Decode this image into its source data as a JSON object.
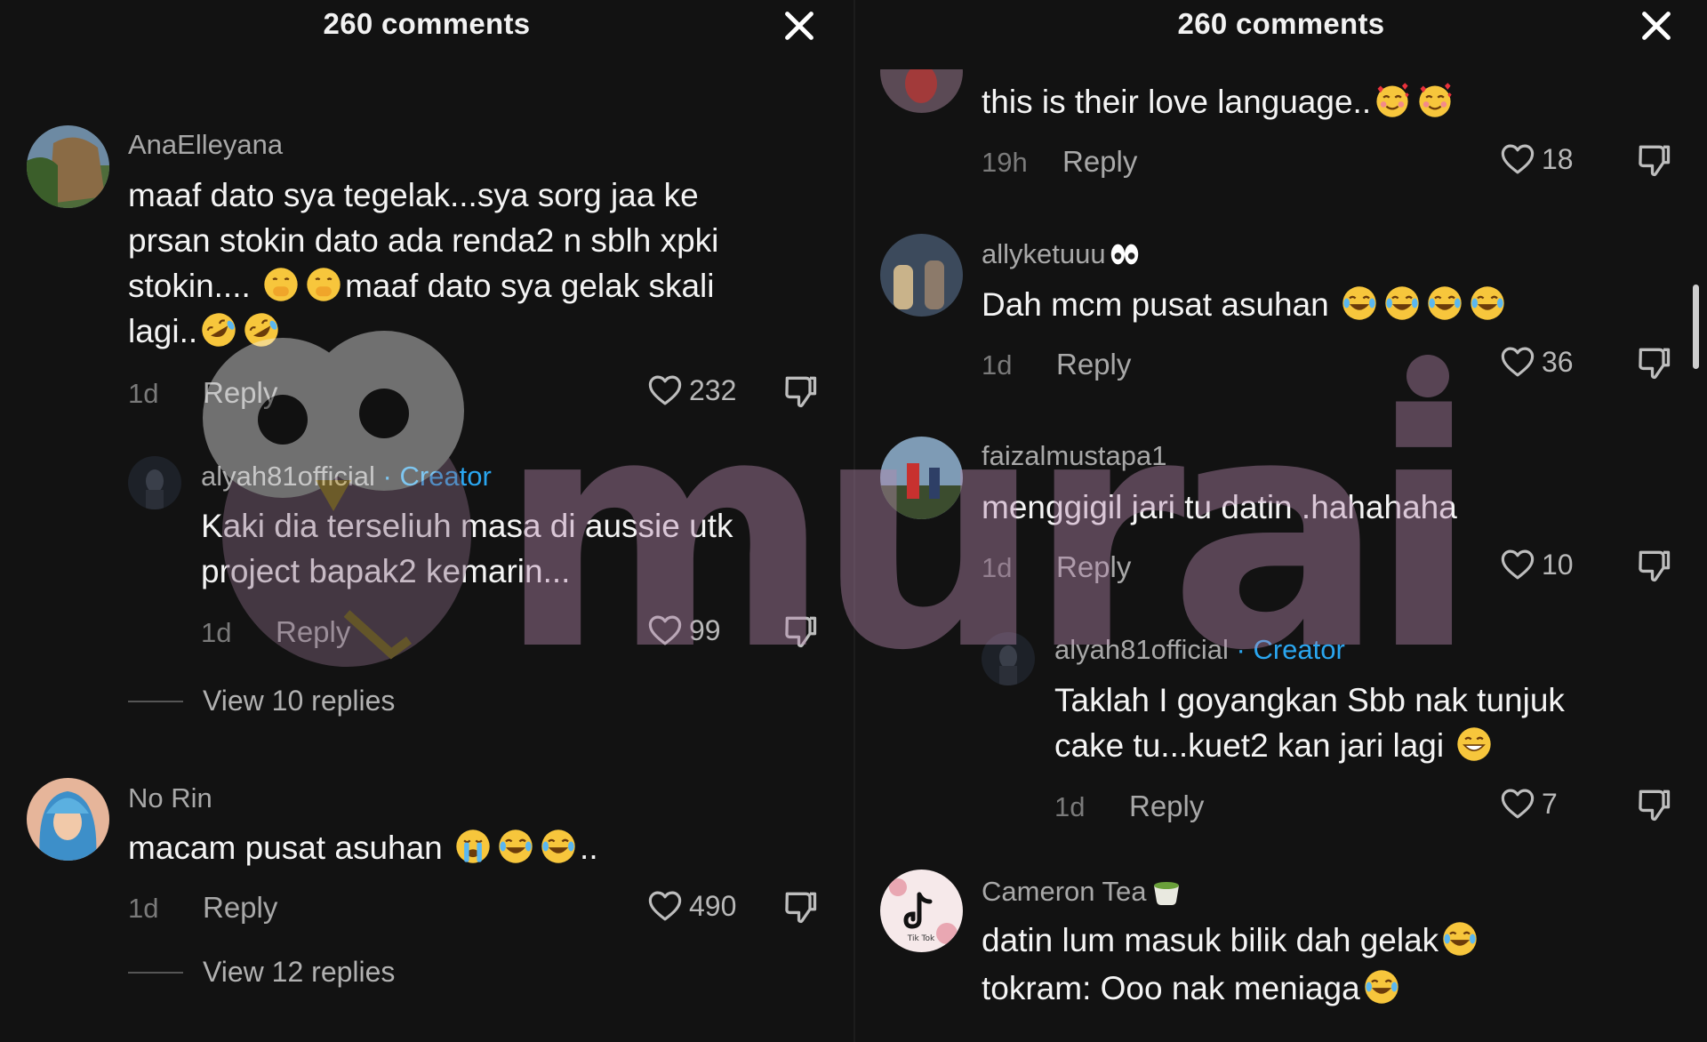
{
  "left_panel": {
    "title": "260 comments",
    "comments": [
      {
        "username": "AnaElleyana",
        "text_lines": [
          "maaf dato sya tegelak...sya sorg jaa ke",
          "prsan stokin dato ada renda2 n sblh xpki",
          "stokin....",
          "maaf dato sya gelak skali",
          "lagi.."
        ],
        "time": "1d",
        "reply": "Reply",
        "likes": "232"
      },
      {
        "username": "alyah81official",
        "creator_tag": " · Creator",
        "text_lines": [
          "Kaki dia terseliuh masa di aussie utk",
          "project bapak2 kemarin..."
        ],
        "time": "1d",
        "reply": "Reply",
        "likes": "99"
      },
      {
        "view_replies": "View 10 replies"
      },
      {
        "username": "No Rin",
        "text": "macam pusat asuhan",
        "text_suffix": "..",
        "time": "1d",
        "reply": "Reply",
        "likes": "490"
      },
      {
        "view_replies": "View 12 replies"
      }
    ]
  },
  "right_panel": {
    "title": "260 comments",
    "comments": [
      {
        "text": "this is their love language..",
        "time": "19h",
        "reply": "Reply",
        "likes": "18"
      },
      {
        "username": "allyketuuu",
        "text": "Dah mcm pusat asuhan",
        "time": "1d",
        "reply": "Reply",
        "likes": "36"
      },
      {
        "username": "faizalmustapa1",
        "text": "menggigil jari tu datin .hahahaha",
        "time": "1d",
        "reply": "Reply",
        "likes": "10"
      },
      {
        "username": "alyah81official",
        "creator_tag": " · Creator",
        "text_lines": [
          "Taklah I goyangkan Sbb nak tunjuk",
          "cake tu...kuet2 kan jari lagi"
        ],
        "time": "1d",
        "reply": "Reply",
        "likes": "7"
      },
      {
        "username": "Cameron Tea",
        "avatar_label": "Tik Tok",
        "text_lines": [
          "datin lum masuk bilik dah gelak",
          "tokram: Ooo nak meniaga"
        ]
      }
    ]
  },
  "watermark": {
    "text": "murai"
  },
  "colors": {
    "background": "#121212",
    "creator": "#2aa6f0",
    "muted": "#a8a8a8"
  },
  "icons": [
    "close-icon",
    "heart-icon",
    "dislike-icon",
    "emoji-laugh-cry-icon",
    "emoji-hand-over-mouth-icon",
    "emoji-rofl-icon",
    "emoji-loudly-crying-icon",
    "emoji-smiling-hearts-icon",
    "emoji-grin-icon",
    "emoji-eyes-icon",
    "emoji-tea-icon"
  ]
}
